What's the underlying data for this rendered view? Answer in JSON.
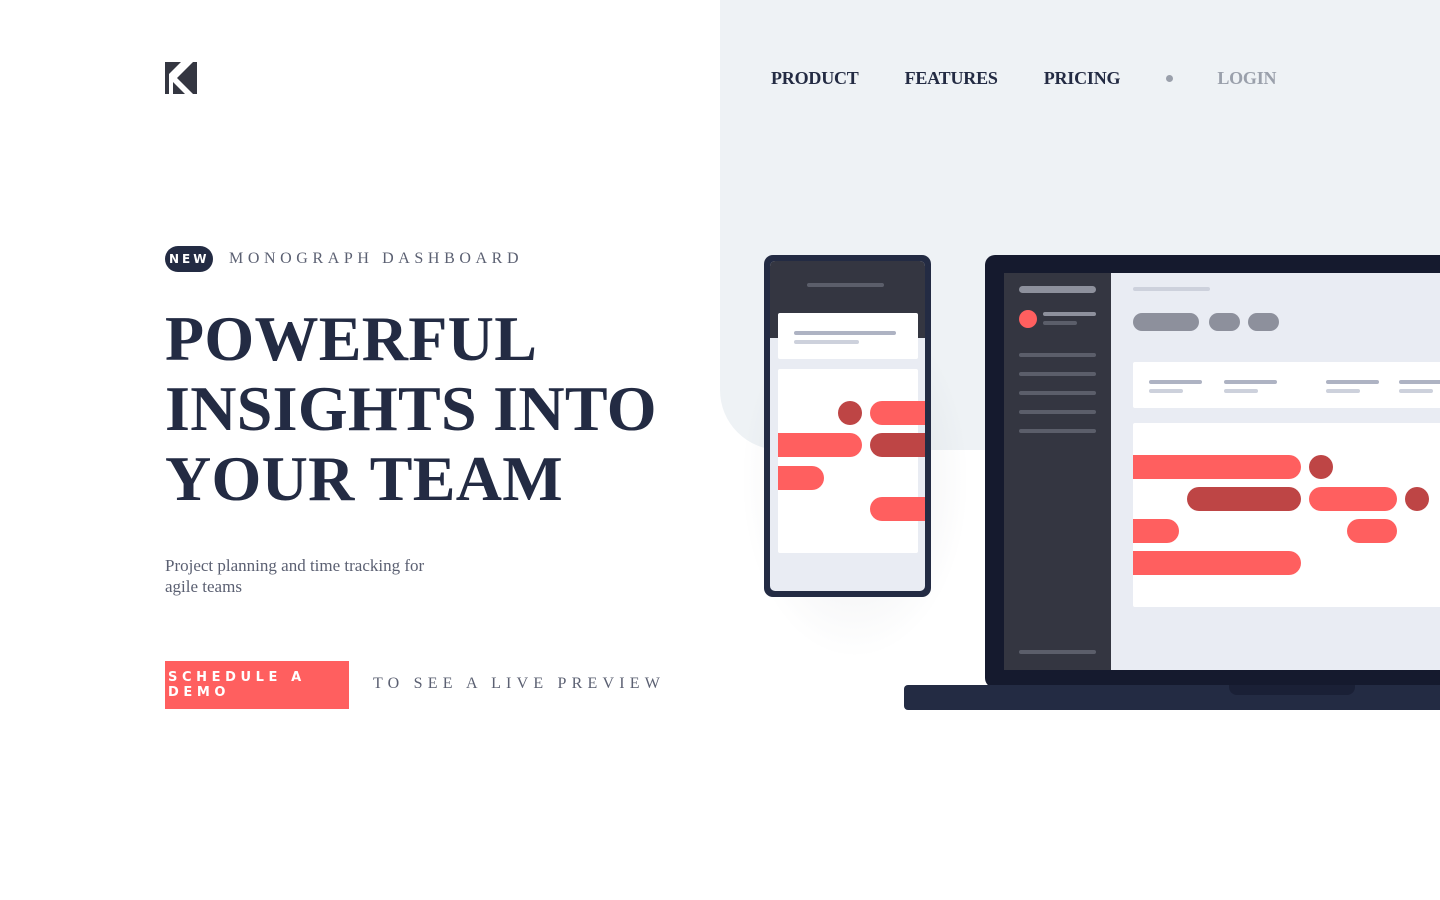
{
  "brand": {
    "logo_icon": "k-logo-icon"
  },
  "nav": {
    "items": [
      "PRODUCT",
      "FEATURES",
      "PRICING"
    ],
    "login": "LOGIN"
  },
  "hero": {
    "badge": "NEW",
    "badge_label": "MONOGRAPH DASHBOARD",
    "headline": [
      "POWERFUL",
      "INSIGHTS INTO",
      "YOUR TEAM"
    ],
    "subtitle_line1": "Project planning and time tracking for",
    "subtitle_line2": "agile teams",
    "cta_label": "SCHEDULE A DEMO",
    "cta_note": "TO SEE A LIVE PREVIEW"
  },
  "colors": {
    "navy": "#232b43",
    "coral": "#ff5f5f",
    "coral_dark": "#be4545",
    "panel_bg": "#eef2f5",
    "muted": "#5b6072"
  },
  "illustration": {
    "phone_icon": "phone-mockup-illustration",
    "laptop_icon": "laptop-mockup-illustration"
  }
}
